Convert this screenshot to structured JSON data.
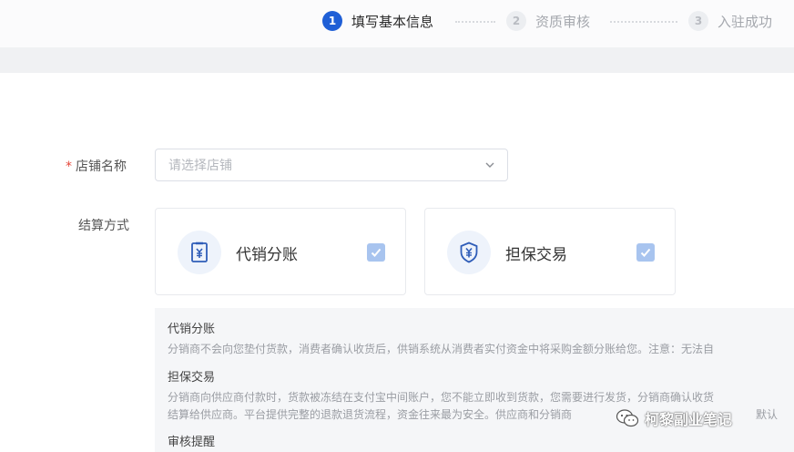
{
  "stepper": {
    "steps": [
      {
        "number": "1",
        "label": "填写基本信息",
        "state": "active"
      },
      {
        "number": "2",
        "label": "资质审核",
        "state": "inactive"
      },
      {
        "number": "3",
        "label": "入驻成功",
        "state": "inactive"
      }
    ]
  },
  "form": {
    "shop_name": {
      "required_mark": "*",
      "label": "店铺名称",
      "placeholder": "请选择店铺"
    },
    "settlement": {
      "label": "结算方式",
      "options": [
        {
          "title": "代销分账",
          "icon": "receipt-yuan-icon",
          "checked": true
        },
        {
          "title": "担保交易",
          "icon": "shield-yuan-icon",
          "checked": true
        }
      ]
    }
  },
  "info": {
    "sections": [
      {
        "heading": "代销分账",
        "lines": [
          "分销商不会向您垫付货款，消费者确认收货后，供销系统从消费者实付资金中将采购金额分账给您。注意：无法自"
        ]
      },
      {
        "heading": "担保交易",
        "lines": [
          "分销商向供应商付款时，货款被冻结在支付宝中间账户，您不能立即收到货款，您需要进行发货，分销商确认收货",
          "结算给供应商。平台提供完整的退款退货流程，资金往来最为安全。供应商和分销商",
          "默认"
        ]
      },
      {
        "heading": "审核提醒",
        "lines": []
      }
    ]
  },
  "watermark": {
    "text": "柯黎副业笔记",
    "icon": "wechat-icon"
  },
  "colors": {
    "primary": "#1f5fd6",
    "check_fill": "#a8c4ef",
    "required": "#e5473a",
    "panel_bg": "#f5f6f8"
  }
}
